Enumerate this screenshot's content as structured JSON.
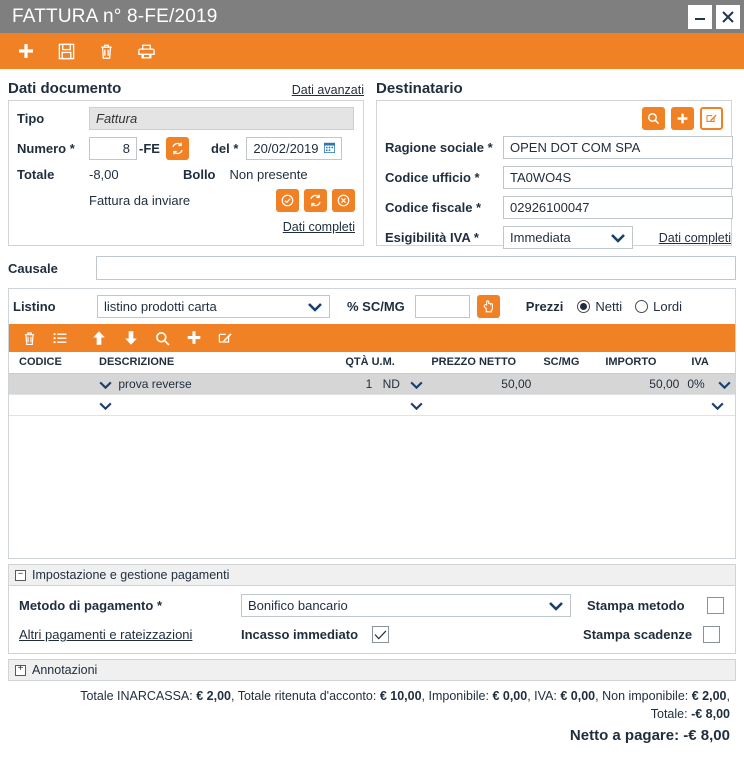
{
  "window": {
    "title": "FATTURA n° 8-FE/2019",
    "minimize_label": "–",
    "close_label": "✕"
  },
  "toolbar": {
    "buttons": [
      {
        "name": "add-icon",
        "tip": "Nuovo"
      },
      {
        "name": "save-icon",
        "tip": "Salva"
      },
      {
        "name": "delete-icon",
        "tip": "Elimina"
      },
      {
        "name": "print-icon",
        "tip": "Stampa"
      }
    ]
  },
  "document_section": {
    "heading": "Dati documento",
    "advanced_link": "Dati avanzati",
    "tipo_label": "Tipo",
    "tipo_value": "Fattura",
    "numero_label": "Numero *",
    "numero_value": "8",
    "numero_suffix": "-FE",
    "del_label": "del *",
    "date_value": "20/02/2019",
    "totale_label": "Totale",
    "totale_value": "-8,00",
    "bollo_label": "Bollo",
    "bollo_value": "Non presente",
    "status_text": "Fattura da inviare",
    "complete_link": "Dati completi"
  },
  "recipient_section": {
    "heading": "Destinatario",
    "ragione_label": "Ragione sociale *",
    "ragione_value": "OPEN DOT COM SPA",
    "ufficio_label": "Codice ufficio *",
    "ufficio_value": "TA0WO4S",
    "fiscale_label": "Codice fiscale *",
    "fiscale_value": "02926100047",
    "esigibilita_label": "Esigibilità IVA *",
    "esigibilita_value": "Immediata",
    "complete_link": "Dati completi"
  },
  "causale": {
    "label": "Causale",
    "value": ""
  },
  "listino": {
    "label": "Listino",
    "value": "listino prodotti carta",
    "scmg_label": "% SC/MG",
    "scmg_value": "",
    "prezzi_label": "Prezzi",
    "netti_label": "Netti",
    "lordi_label": "Lordi",
    "selected": "Netti"
  },
  "items": {
    "columns": [
      "CODICE",
      "DESCRIZIONE",
      "QTÀ U.M.",
      "PREZZO NETTO",
      "SC/MG",
      "IMPORTO",
      "IVA"
    ],
    "rows": [
      {
        "codice": "",
        "descrizione": "prova reverse",
        "qta": "1",
        "um": "ND",
        "prezzo_netto": "50,00",
        "scmg": "",
        "importo": "50,00",
        "iva": "0%",
        "selected": true
      },
      {
        "codice": "",
        "descrizione": "",
        "qta": "",
        "um": "",
        "prezzo_netto": "",
        "scmg": "",
        "importo": "",
        "iva": "",
        "selected": false
      }
    ]
  },
  "payments": {
    "section_title": "Impostazione e gestione pagamenti",
    "expander": "–",
    "metodo_label": "Metodo di pagamento *",
    "metodo_value": "Bonifico bancario",
    "altri_link": "Altri pagamenti e rateizzazioni",
    "incasso_label": "Incasso immediato",
    "incasso_checked": true,
    "stampa_metodo_label": "Stampa metodo",
    "stampa_metodo_checked": false,
    "stampa_scadenze_label": "Stampa scadenze",
    "stampa_scadenze_checked": false
  },
  "annotations": {
    "section_title": "Annotazioni",
    "expander": "+"
  },
  "totals": {
    "inarcassa_label": "Totale INARCASSA:",
    "inarcassa_value": "€ 2,00",
    "ritenuta_label": "Totale ritenuta d'acconto:",
    "ritenuta_value": "€ 10,00",
    "imponibile_label": "Imponibile:",
    "imponibile_value": "€ 0,00",
    "iva_label": "IVA:",
    "iva_value": "€ 0,00",
    "non_imponibile_label": "Non imponibile:",
    "non_imponibile_value": "€ 2,00",
    "totale_label": "Totale:",
    "totale_value": "-€ 8,00",
    "netto_label": "Netto a pagare:",
    "netto_value": "-€ 8,00"
  },
  "colors": {
    "accent": "#F08124",
    "titlebar": "#7f7f7f",
    "chevron": "#1c3f6e"
  }
}
